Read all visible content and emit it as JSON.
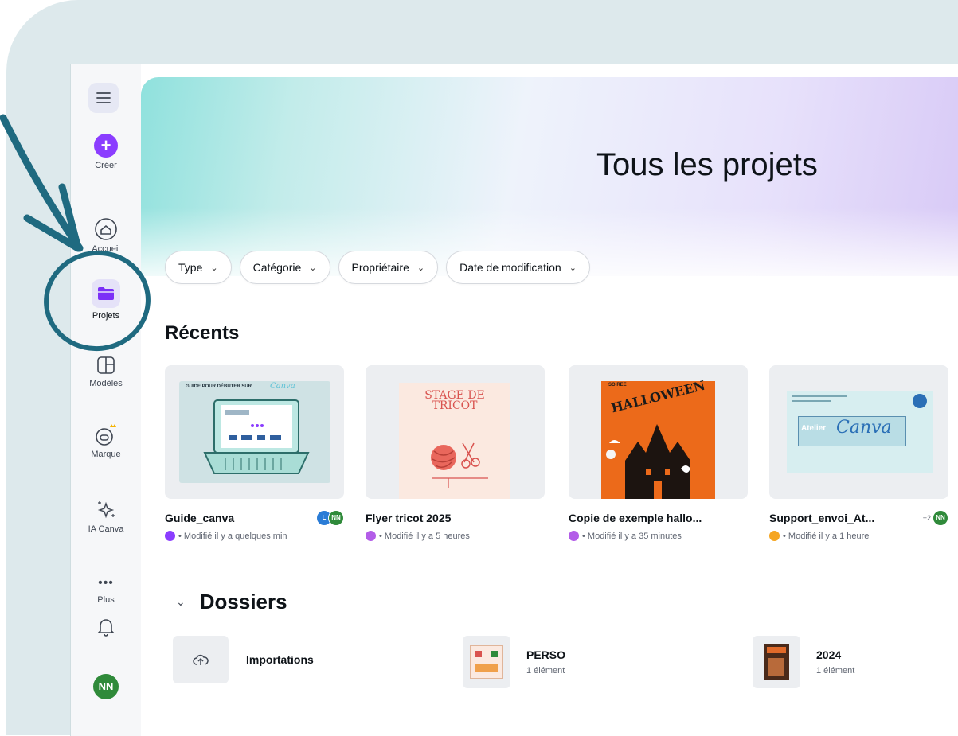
{
  "sidebar": {
    "create_label": "Créer",
    "items": [
      {
        "label": "Accueil",
        "icon": "home-icon"
      },
      {
        "label": "Projets",
        "icon": "folder-icon"
      },
      {
        "label": "Modèles",
        "icon": "templates-icon"
      },
      {
        "label": "Marque",
        "icon": "brand-icon"
      },
      {
        "label": "IA Canva",
        "icon": "sparkle-icon"
      },
      {
        "label": "Plus",
        "icon": "more-icon"
      }
    ],
    "notifications_icon": "bell-icon",
    "avatar": "NN"
  },
  "page": {
    "title": "Tous les projets"
  },
  "filters": [
    "Type",
    "Catégorie",
    "Propriétaire",
    "Date de modification"
  ],
  "recents": {
    "title": "Récents",
    "cards": [
      {
        "title": "Guide_canva",
        "modified": "• Modifié il y a quelques min",
        "thumb_text": "GUIDE POUR DÉBUTER SUR",
        "thumb_brand": "Canva",
        "avatars": [
          "L",
          "NN"
        ],
        "extra": ""
      },
      {
        "title": "Flyer tricot 2025",
        "modified": "• Modifié il y a 5 heures",
        "thumb_text": "STAGE DE TRICOT",
        "avatars": [],
        "extra": ""
      },
      {
        "title": "Copie de exemple hallo...",
        "modified": "• Modifié il y a 35 minutes",
        "thumb_text": "HALLOWEEN",
        "thumb_small": "SOIREE",
        "avatars": [],
        "extra": ""
      },
      {
        "title": "Support_envoi_At...",
        "modified": "• Modifié il y a 1 heure",
        "thumb_text": "Canva",
        "thumb_small": "Atelier",
        "avatars": [
          "NN"
        ],
        "extra": "+2"
      }
    ]
  },
  "folders": {
    "title": "Dossiers",
    "items": [
      {
        "name": "Importations",
        "count": ""
      },
      {
        "name": "PERSO",
        "count": "1 élément"
      },
      {
        "name": "2024",
        "count": "1 élément"
      }
    ]
  },
  "colors": {
    "accent": "#8b3dff",
    "annotation": "#1f6a80",
    "avatar_green": "#2f8a3a"
  }
}
